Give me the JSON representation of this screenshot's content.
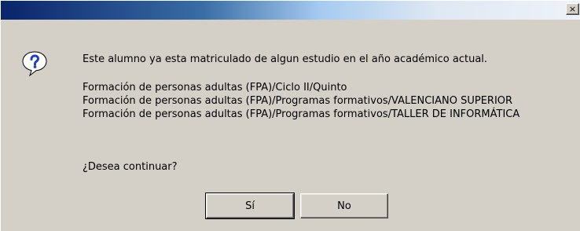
{
  "title_bar": {
    "close_label": "×",
    "close_icon": "close-icon"
  },
  "message": {
    "icon": "question-icon",
    "main": "Este alumno ya esta matriculado de algun estudio en el año académico actual.",
    "lines": [
      "Formación de personas adultas (FPA)/Ciclo II/Quinto",
      "Formación de personas adultas (FPA)/Programas formativos/VALENCIANO SUPERIOR",
      "Formación de personas adultas (FPA)/Programas formativos/TALLER DE INFORMÁTICA"
    ],
    "question": "¿Desea continuar?"
  },
  "buttons": {
    "yes_label": "Sí",
    "no_label": "No"
  },
  "colors": {
    "dialog_bg": "#d4d0c8",
    "titlebar_start": "#0a246a",
    "titlebar_end": "#eef2f8",
    "icon_fill": "#ffffff",
    "icon_mark": "#1f3fbf"
  }
}
